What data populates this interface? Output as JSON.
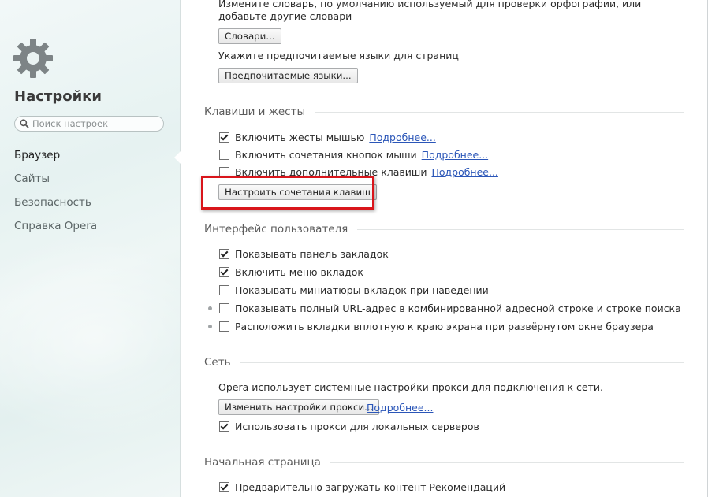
{
  "sidebar": {
    "title": "Настройки",
    "search_placeholder": "Поиск настроек",
    "nav": [
      {
        "label": "Браузер",
        "active": true
      },
      {
        "label": "Сайты"
      },
      {
        "label": "Безопасность"
      },
      {
        "label": "Справка Opera"
      }
    ]
  },
  "dictionary": {
    "description": "Измените словарь, по умолчанию используемый для проверки орфографии, или добавьте другие словари",
    "dict_button": "Словари...",
    "lang_description": "Укажите предпочитаемые языки для страниц",
    "lang_button": "Предпочитаемые языки..."
  },
  "keys": {
    "title": "Клавиши и жесты",
    "options": [
      {
        "label": "Включить жесты мышью",
        "checked": true,
        "link": "Подробнее..."
      },
      {
        "label": "Включить сочетания кнопок мыши",
        "checked": false,
        "link": "Подробнее..."
      },
      {
        "label": "Включить дополнительные клавиши",
        "checked": false,
        "link": "Подробнее..."
      }
    ],
    "shortcuts_button": "Настроить сочетания клавиш"
  },
  "ui": {
    "title": "Интерфейс пользователя",
    "options": [
      {
        "label": "Показывать панель закладок",
        "checked": true
      },
      {
        "label": "Включить меню вкладок",
        "checked": true
      },
      {
        "label": "Показывать миниатюры вкладок при наведении",
        "checked": false
      },
      {
        "label": "Показывать полный URL-адрес в комбинированной адресной строке и строке поиска",
        "checked": false
      },
      {
        "label": "Расположить вкладки вплотную к краю экрана при развёрнутом окне браузера",
        "checked": false
      }
    ]
  },
  "network": {
    "title": "Сеть",
    "description": "Opera использует системные настройки прокси для подключения к сети.",
    "proxy_button": "Изменить настройки прокси...",
    "link": "Подробнее...",
    "local_proxy": {
      "label": "Использовать прокси для локальных серверов",
      "checked": true
    }
  },
  "start_page": {
    "title": "Начальная страница",
    "preload": {
      "label": "Предварительно загружать контент Рекомендаций",
      "checked": true
    }
  },
  "colors": {
    "highlight": "#d9151b",
    "link": "#2b56b8"
  }
}
